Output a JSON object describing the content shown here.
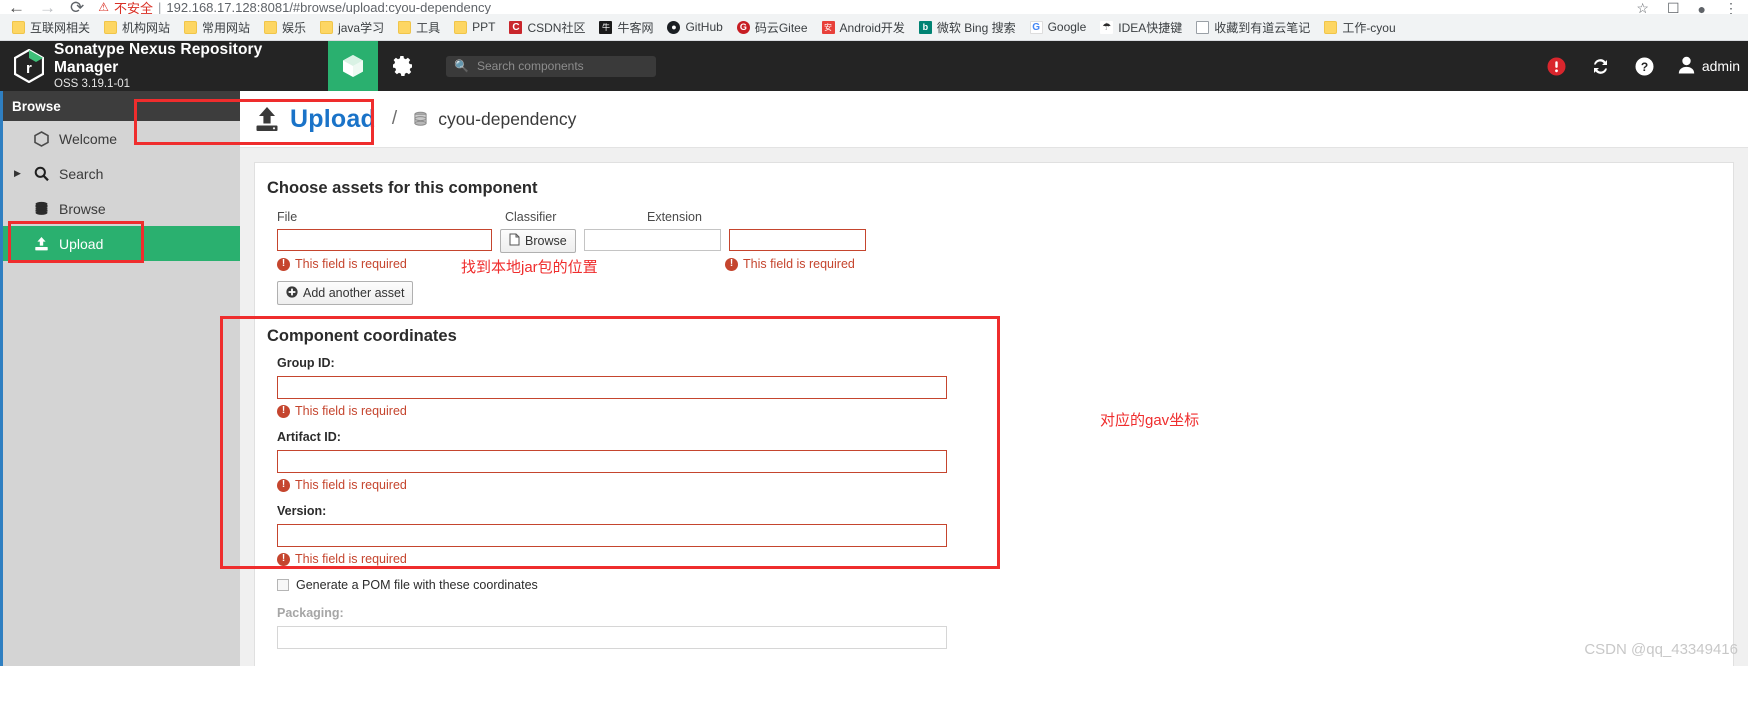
{
  "browser": {
    "nav": {
      "back": "←",
      "forward": "→",
      "reload": "⟳"
    },
    "security_warning": "不安全",
    "url": "192.168.17.128:8081/#browse/upload:cyou-dependency",
    "right_icons": [
      "star-icon",
      "extension-icon",
      "profile-icon",
      "menu-icon"
    ],
    "bookmarks": [
      {
        "label": "互联网相关",
        "icon": "folder-icon",
        "kind": "folder"
      },
      {
        "label": "机构网站",
        "icon": "folder-icon",
        "kind": "folder"
      },
      {
        "label": "常用网站",
        "icon": "folder-icon",
        "kind": "folder"
      },
      {
        "label": "娱乐",
        "icon": "folder-icon",
        "kind": "folder"
      },
      {
        "label": "java学习",
        "icon": "folder-icon",
        "kind": "folder"
      },
      {
        "label": "工具",
        "icon": "folder-icon",
        "kind": "folder"
      },
      {
        "label": "PPT",
        "icon": "folder-icon",
        "kind": "folder"
      },
      {
        "label": "CSDN社区",
        "icon": "csdn-icon",
        "kind": "csdn",
        "glyph": "C"
      },
      {
        "label": "牛客网",
        "icon": "nowcoder-icon",
        "kind": "nowcoder",
        "glyph": "牛"
      },
      {
        "label": "GitHub",
        "icon": "github-icon",
        "kind": "github",
        "glyph": "●"
      },
      {
        "label": "码云Gitee",
        "icon": "gitee-icon",
        "kind": "gitee",
        "glyph": "G"
      },
      {
        "label": "Android开发",
        "icon": "android-icon",
        "kind": "android",
        "glyph": "安"
      },
      {
        "label": "微软 Bing 搜索",
        "icon": "bing-icon",
        "kind": "bing",
        "glyph": "b"
      },
      {
        "label": "Google",
        "icon": "google-icon",
        "kind": "google",
        "glyph": "G"
      },
      {
        "label": "IDEA快捷键",
        "icon": "idea-icon",
        "kind": "idea",
        "glyph": "☂"
      },
      {
        "label": "收藏到有道云笔记",
        "icon": "document-icon",
        "kind": "doc",
        "glyph": ""
      },
      {
        "label": "工作-cyou",
        "icon": "folder-icon",
        "kind": "folder"
      }
    ]
  },
  "header": {
    "title": "Sonatype Nexus Repository Manager",
    "subtitle": "OSS 3.19.1-01",
    "tabs": [
      {
        "name": "browse-tab",
        "icon": "cube-icon",
        "active": true
      },
      {
        "name": "settings-tab",
        "icon": "gear-icon",
        "active": false
      }
    ],
    "search_placeholder": "Search components",
    "search_value": "",
    "alert_icon": "alert-icon",
    "refresh_icon": "refresh-icon",
    "help_icon": "help-icon",
    "user_icon": "user-icon",
    "user_name": "admin",
    "accent_green": "#2ab06f",
    "alert_red": "#d9262d"
  },
  "sidebar": {
    "section_title": "Browse",
    "items": [
      {
        "label": "Welcome",
        "icon": "hexagon-icon",
        "expandable": false,
        "active": false
      },
      {
        "label": "Search",
        "icon": "search-icon",
        "expandable": true,
        "active": false
      },
      {
        "label": "Browse",
        "icon": "database-icon",
        "expandable": false,
        "active": false
      },
      {
        "label": "Upload",
        "icon": "upload-icon",
        "expandable": false,
        "active": true
      }
    ]
  },
  "upload_page": {
    "icon": "upload-icon",
    "title": "Upload",
    "separator": "/",
    "repo_icon": "repository-icon",
    "repository": "cyou-dependency",
    "assets_section_title": "Choose assets for this component",
    "columns": {
      "file": "File",
      "classifier": "Classifier",
      "extension": "Extension"
    },
    "file_value": "",
    "classifier_value": "",
    "extension_value": "",
    "browse_button": "Browse",
    "browse_icon": "file-icon",
    "add_asset_button": "Add another asset",
    "add_asset_icon": "plus-circle-icon",
    "required_message": "This field is required",
    "coordinates_section_title": "Component coordinates",
    "fields": [
      {
        "label": "Group ID:",
        "value": "",
        "error": "This field is required",
        "muted": false
      },
      {
        "label": "Artifact ID:",
        "value": "",
        "error": "This field is required",
        "muted": false
      },
      {
        "label": "Version:",
        "value": "",
        "error": "This field is required",
        "muted": false
      }
    ],
    "generate_pom_label": "Generate a POM file with these coordinates",
    "generate_pom_checked": false,
    "packaging_label": "Packaging:",
    "packaging_value": ""
  },
  "annotations": {
    "color": "#ef2d2d",
    "jar_location_note": "找到本地jar包的位置",
    "gav_note": "对应的gav坐标"
  },
  "watermark": "CSDN @qq_43349416"
}
